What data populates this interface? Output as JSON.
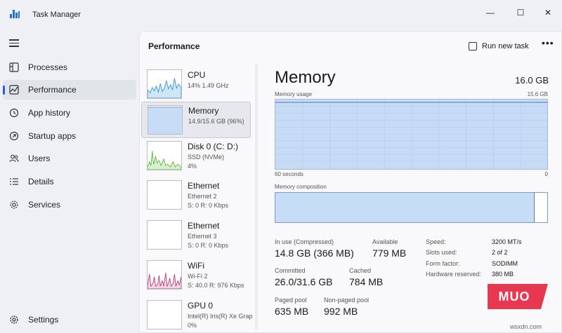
{
  "window": {
    "title": "Task Manager",
    "controls": {
      "minimize": "—",
      "maximize": "☐",
      "close": "✕"
    }
  },
  "sidebar": {
    "items": [
      {
        "label": "Processes",
        "icon": "processes-icon"
      },
      {
        "label": "Performance",
        "icon": "performance-icon",
        "active": true
      },
      {
        "label": "App history",
        "icon": "app-history-icon"
      },
      {
        "label": "Startup apps",
        "icon": "startup-apps-icon"
      },
      {
        "label": "Users",
        "icon": "users-icon"
      },
      {
        "label": "Details",
        "icon": "details-icon"
      },
      {
        "label": "Services",
        "icon": "services-icon"
      }
    ],
    "settings_label": "Settings"
  },
  "header": {
    "title": "Performance",
    "run_task_label": "Run new task",
    "more_label": "•••"
  },
  "devices": [
    {
      "name": "CPU",
      "line1": "14%  1.49 GHz",
      "line2": "",
      "line3": ""
    },
    {
      "name": "Memory",
      "line1": "14.9/15.6 GB (96%)",
      "line2": "",
      "line3": ""
    },
    {
      "name": "Disk 0 (C: D:)",
      "line1": "SSD (NVMe)",
      "line2": "4%",
      "line3": ""
    },
    {
      "name": "Ethernet",
      "line1": "Ethernet 2",
      "line2": "S: 0  R: 0 Kbps",
      "line3": ""
    },
    {
      "name": "Ethernet",
      "line1": "Ethernet 3",
      "line2": "S: 0  R: 0 Kbps",
      "line3": ""
    },
    {
      "name": "WiFi",
      "line1": "Wi-Fi 2",
      "line2": "S: 40.0  R: 976 Kbps",
      "line3": ""
    },
    {
      "name": "GPU 0",
      "line1": "Intel(R) Iris(R) Xe Grap",
      "line2": "0%",
      "line3": ""
    }
  ],
  "memory": {
    "heading": "Memory",
    "total": "16.0 GB",
    "usage_graph_label": "Memory usage",
    "usage_graph_max": "15.6 GB",
    "axis_left": "60 seconds",
    "axis_right": "0",
    "usage_fraction": 0.96,
    "composition_label": "Memory composition",
    "composition_in_use_fraction": 0.953,
    "stats": {
      "in_use_label": "In use (Compressed)",
      "in_use_value": "14.8 GB (366 MB)",
      "available_label": "Available",
      "available_value": "779 MB",
      "committed_label": "Committed",
      "committed_value": "26.0/31.6 GB",
      "cached_label": "Cached",
      "cached_value": "784 MB",
      "paged_label": "Paged pool",
      "paged_value": "635 MB",
      "nonpaged_label": "Non-paged pool",
      "nonpaged_value": "992 MB"
    },
    "specs": {
      "speed_label": "Speed:",
      "speed_value": "3200 MT/s",
      "slots_label": "Slots used:",
      "slots_value": "2 of 2",
      "form_label": "Form factor:",
      "form_value": "SODIMM",
      "reserved_label": "Hardware reserved:",
      "reserved_value": "380 MB"
    }
  },
  "watermark": {
    "logo": "MUO",
    "site": "wsxdn.com"
  },
  "colors": {
    "accent": "#2b5fd0",
    "memory_fill": "#c7dcf6",
    "cpu_line": "#1a8ad6",
    "disk_line": "#4caf27",
    "wifi_line": "#b0266a",
    "logo": "#e8384f"
  }
}
